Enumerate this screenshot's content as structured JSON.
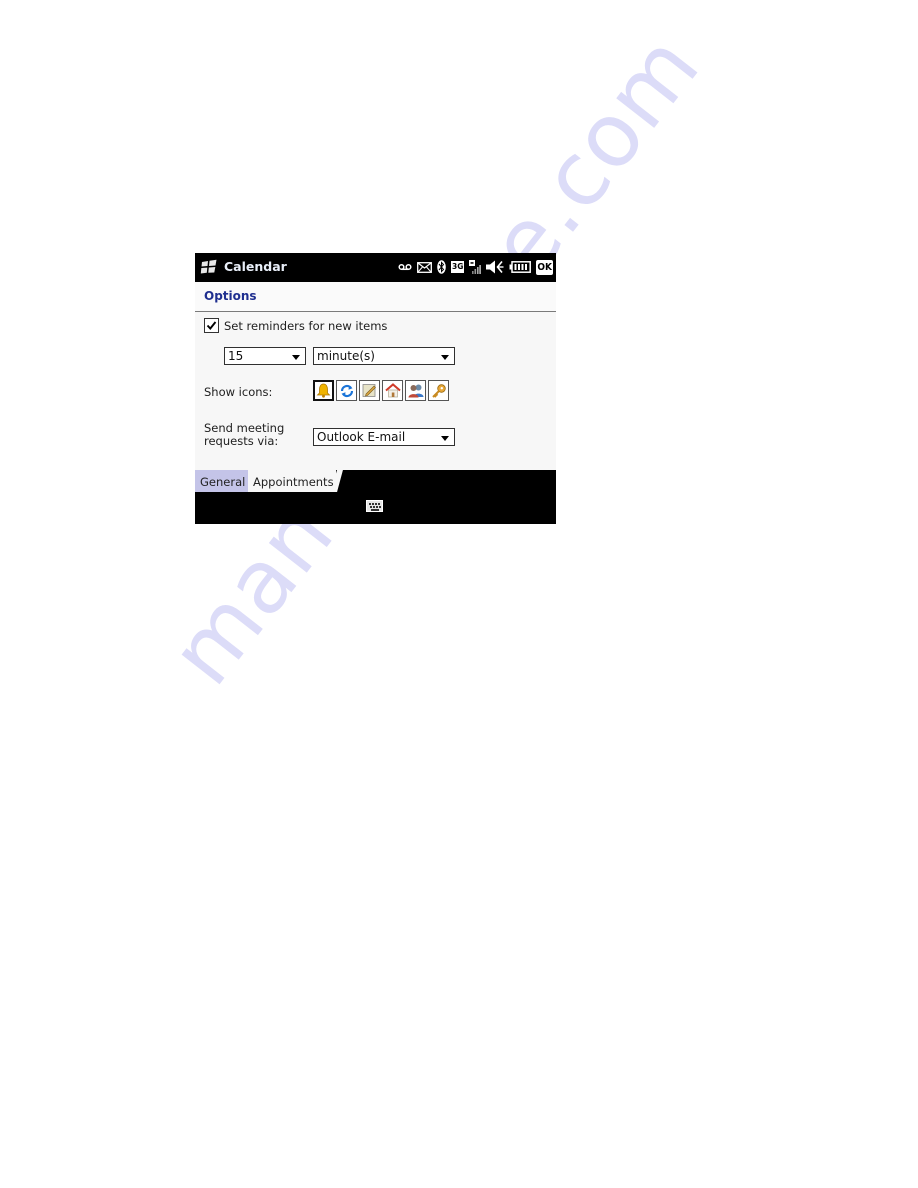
{
  "watermark": "manualshive.com",
  "titlebar": {
    "app_title": "Calendar",
    "status_icons": [
      "voicemail-icon",
      "message-icon",
      "bluetooth-icon",
      "3g-icon",
      "signal-icon",
      "volume-mute-icon",
      "battery-icon"
    ],
    "badge_3g": "3G",
    "ok_label": "OK"
  },
  "header": {
    "title": "Options"
  },
  "form": {
    "reminders": {
      "label": "Set reminders for new items",
      "checked": true
    },
    "reminder_amount": {
      "value": "15"
    },
    "reminder_unit": {
      "value": "minute(s)"
    },
    "show_icons": {
      "label": "Show icons:",
      "icons": [
        {
          "name": "reminder-bell-icon",
          "selected": true
        },
        {
          "name": "recurring-icon",
          "selected": false
        },
        {
          "name": "note-icon",
          "selected": false
        },
        {
          "name": "home-icon",
          "selected": false
        },
        {
          "name": "meeting-attendees-icon",
          "selected": false
        },
        {
          "name": "private-key-icon",
          "selected": false
        }
      ]
    },
    "send_via": {
      "label_line1": "Send meeting",
      "label_line2": "requests via:",
      "value": "Outlook E-mail"
    }
  },
  "tabs": [
    {
      "label": "General",
      "active": false
    },
    {
      "label": "Appointments",
      "active": true
    }
  ],
  "softbar": {
    "input_icon": "keyboard-icon"
  },
  "colors": {
    "header_title": "#1f2f8f",
    "inactive_tab": "#c4c4e8",
    "titlebar_bg": "#000000"
  }
}
